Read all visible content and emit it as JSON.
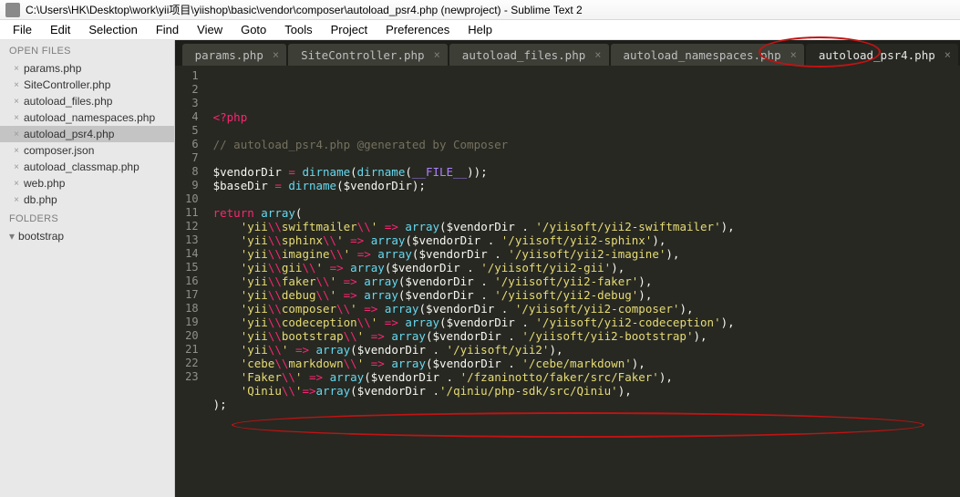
{
  "titlebar": {
    "text": "C:\\Users\\HK\\Desktop\\work\\yii项目\\yiishop\\basic\\vendor\\composer\\autoload_psr4.php (newproject) - Sublime Text 2"
  },
  "menu": [
    "File",
    "Edit",
    "Selection",
    "Find",
    "View",
    "Goto",
    "Tools",
    "Project",
    "Preferences",
    "Help"
  ],
  "sidebar": {
    "openfiles_head": "OPEN FILES",
    "openfiles": [
      "params.php",
      "SiteController.php",
      "autoload_files.php",
      "autoload_namespaces.php",
      "autoload_psr4.php",
      "composer.json",
      "autoload_classmap.php",
      "web.php",
      "db.php"
    ],
    "active_index": 4,
    "folders_head": "FOLDERS",
    "folders": [
      "bootstrap"
    ]
  },
  "tabs": {
    "items": [
      "params.php",
      "SiteController.php",
      "autoload_files.php",
      "autoload_namespaces.php",
      "autoload_psr4.php"
    ],
    "active_index": 4
  },
  "code": {
    "first_line": 1,
    "lines": [
      [
        [
          "op",
          "<?php"
        ]
      ],
      [],
      [
        [
          "cm",
          "// autoload_psr4.php @generated by Composer"
        ]
      ],
      [],
      [
        [
          "var",
          "$vendorDir "
        ],
        [
          "op",
          "="
        ],
        [
          "p",
          " "
        ],
        [
          "fn",
          "dirname"
        ],
        [
          "p",
          "("
        ],
        [
          "fn",
          "dirname"
        ],
        [
          "p",
          "("
        ],
        [
          "const",
          "__FILE__"
        ],
        [
          "p",
          "));"
        ]
      ],
      [
        [
          "var",
          "$baseDir "
        ],
        [
          "op",
          "="
        ],
        [
          "p",
          " "
        ],
        [
          "fn",
          "dirname"
        ],
        [
          "p",
          "("
        ],
        [
          "var",
          "$vendorDir"
        ],
        [
          "p",
          ");"
        ]
      ],
      [],
      [
        [
          "key",
          "return"
        ],
        [
          "p",
          " "
        ],
        [
          "fn",
          "array"
        ],
        [
          "p",
          "("
        ]
      ],
      [
        [
          "p",
          "    "
        ],
        [
          "str",
          "'yii"
        ],
        [
          "esc",
          "\\\\"
        ],
        [
          "str",
          "swiftmailer"
        ],
        [
          "esc",
          "\\\\"
        ],
        [
          "str",
          "'"
        ],
        [
          "p",
          " "
        ],
        [
          "op",
          "=>"
        ],
        [
          "p",
          " "
        ],
        [
          "fn",
          "array"
        ],
        [
          "p",
          "("
        ],
        [
          "var",
          "$vendorDir"
        ],
        [
          "p",
          " . "
        ],
        [
          "str",
          "'/yiisoft/yii2-swiftmailer'"
        ],
        [
          "p",
          "),"
        ]
      ],
      [
        [
          "p",
          "    "
        ],
        [
          "str",
          "'yii"
        ],
        [
          "esc",
          "\\\\"
        ],
        [
          "str",
          "sphinx"
        ],
        [
          "esc",
          "\\\\"
        ],
        [
          "str",
          "'"
        ],
        [
          "p",
          " "
        ],
        [
          "op",
          "=>"
        ],
        [
          "p",
          " "
        ],
        [
          "fn",
          "array"
        ],
        [
          "p",
          "("
        ],
        [
          "var",
          "$vendorDir"
        ],
        [
          "p",
          " . "
        ],
        [
          "str",
          "'/yiisoft/yii2-sphinx'"
        ],
        [
          "p",
          "),"
        ]
      ],
      [
        [
          "p",
          "    "
        ],
        [
          "str",
          "'yii"
        ],
        [
          "esc",
          "\\\\"
        ],
        [
          "str",
          "imagine"
        ],
        [
          "esc",
          "\\\\"
        ],
        [
          "str",
          "'"
        ],
        [
          "p",
          " "
        ],
        [
          "op",
          "=>"
        ],
        [
          "p",
          " "
        ],
        [
          "fn",
          "array"
        ],
        [
          "p",
          "("
        ],
        [
          "var",
          "$vendorDir"
        ],
        [
          "p",
          " . "
        ],
        [
          "str",
          "'/yiisoft/yii2-imagine'"
        ],
        [
          "p",
          "),"
        ]
      ],
      [
        [
          "p",
          "    "
        ],
        [
          "str",
          "'yii"
        ],
        [
          "esc",
          "\\\\"
        ],
        [
          "str",
          "gii"
        ],
        [
          "esc",
          "\\\\"
        ],
        [
          "str",
          "'"
        ],
        [
          "p",
          " "
        ],
        [
          "op",
          "=>"
        ],
        [
          "p",
          " "
        ],
        [
          "fn",
          "array"
        ],
        [
          "p",
          "("
        ],
        [
          "var",
          "$vendorDir"
        ],
        [
          "p",
          " . "
        ],
        [
          "str",
          "'/yiisoft/yii2-gii'"
        ],
        [
          "p",
          "),"
        ]
      ],
      [
        [
          "p",
          "    "
        ],
        [
          "str",
          "'yii"
        ],
        [
          "esc",
          "\\\\"
        ],
        [
          "str",
          "faker"
        ],
        [
          "esc",
          "\\\\"
        ],
        [
          "str",
          "'"
        ],
        [
          "p",
          " "
        ],
        [
          "op",
          "=>"
        ],
        [
          "p",
          " "
        ],
        [
          "fn",
          "array"
        ],
        [
          "p",
          "("
        ],
        [
          "var",
          "$vendorDir"
        ],
        [
          "p",
          " . "
        ],
        [
          "str",
          "'/yiisoft/yii2-faker'"
        ],
        [
          "p",
          "),"
        ]
      ],
      [
        [
          "p",
          "    "
        ],
        [
          "str",
          "'yii"
        ],
        [
          "esc",
          "\\\\"
        ],
        [
          "str",
          "debug"
        ],
        [
          "esc",
          "\\\\"
        ],
        [
          "str",
          "'"
        ],
        [
          "p",
          " "
        ],
        [
          "op",
          "=>"
        ],
        [
          "p",
          " "
        ],
        [
          "fn",
          "array"
        ],
        [
          "p",
          "("
        ],
        [
          "var",
          "$vendorDir"
        ],
        [
          "p",
          " . "
        ],
        [
          "str",
          "'/yiisoft/yii2-debug'"
        ],
        [
          "p",
          "),"
        ]
      ],
      [
        [
          "p",
          "    "
        ],
        [
          "str",
          "'yii"
        ],
        [
          "esc",
          "\\\\"
        ],
        [
          "str",
          "composer"
        ],
        [
          "esc",
          "\\\\"
        ],
        [
          "str",
          "'"
        ],
        [
          "p",
          " "
        ],
        [
          "op",
          "=>"
        ],
        [
          "p",
          " "
        ],
        [
          "fn",
          "array"
        ],
        [
          "p",
          "("
        ],
        [
          "var",
          "$vendorDir"
        ],
        [
          "p",
          " . "
        ],
        [
          "str",
          "'/yiisoft/yii2-composer'"
        ],
        [
          "p",
          "),"
        ]
      ],
      [
        [
          "p",
          "    "
        ],
        [
          "str",
          "'yii"
        ],
        [
          "esc",
          "\\\\"
        ],
        [
          "str",
          "codeception"
        ],
        [
          "esc",
          "\\\\"
        ],
        [
          "str",
          "'"
        ],
        [
          "p",
          " "
        ],
        [
          "op",
          "=>"
        ],
        [
          "p",
          " "
        ],
        [
          "fn",
          "array"
        ],
        [
          "p",
          "("
        ],
        [
          "var",
          "$vendorDir"
        ],
        [
          "p",
          " . "
        ],
        [
          "str",
          "'/yiisoft/yii2-codeception'"
        ],
        [
          "p",
          "),"
        ]
      ],
      [
        [
          "p",
          "    "
        ],
        [
          "str",
          "'yii"
        ],
        [
          "esc",
          "\\\\"
        ],
        [
          "str",
          "bootstrap"
        ],
        [
          "esc",
          "\\\\"
        ],
        [
          "str",
          "'"
        ],
        [
          "p",
          " "
        ],
        [
          "op",
          "=>"
        ],
        [
          "p",
          " "
        ],
        [
          "fn",
          "array"
        ],
        [
          "p",
          "("
        ],
        [
          "var",
          "$vendorDir"
        ],
        [
          "p",
          " . "
        ],
        [
          "str",
          "'/yiisoft/yii2-bootstrap'"
        ],
        [
          "p",
          "),"
        ]
      ],
      [
        [
          "p",
          "    "
        ],
        [
          "str",
          "'yii"
        ],
        [
          "esc",
          "\\\\"
        ],
        [
          "str",
          "'"
        ],
        [
          "p",
          " "
        ],
        [
          "op",
          "=>"
        ],
        [
          "p",
          " "
        ],
        [
          "fn",
          "array"
        ],
        [
          "p",
          "("
        ],
        [
          "var",
          "$vendorDir"
        ],
        [
          "p",
          " . "
        ],
        [
          "str",
          "'/yiisoft/yii2'"
        ],
        [
          "p",
          "),"
        ]
      ],
      [
        [
          "p",
          "    "
        ],
        [
          "str",
          "'cebe"
        ],
        [
          "esc",
          "\\\\"
        ],
        [
          "str",
          "markdown"
        ],
        [
          "esc",
          "\\\\"
        ],
        [
          "str",
          "'"
        ],
        [
          "p",
          " "
        ],
        [
          "op",
          "=>"
        ],
        [
          "p",
          " "
        ],
        [
          "fn",
          "array"
        ],
        [
          "p",
          "("
        ],
        [
          "var",
          "$vendorDir"
        ],
        [
          "p",
          " . "
        ],
        [
          "str",
          "'/cebe/markdown'"
        ],
        [
          "p",
          "),"
        ]
      ],
      [
        [
          "p",
          "    "
        ],
        [
          "str",
          "'Faker"
        ],
        [
          "esc",
          "\\\\"
        ],
        [
          "str",
          "'"
        ],
        [
          "p",
          " "
        ],
        [
          "op",
          "=>"
        ],
        [
          "p",
          " "
        ],
        [
          "fn",
          "array"
        ],
        [
          "p",
          "("
        ],
        [
          "var",
          "$vendorDir"
        ],
        [
          "p",
          " . "
        ],
        [
          "str",
          "'/fzaninotto/faker/src/Faker'"
        ],
        [
          "p",
          "),"
        ]
      ],
      [
        [
          "p",
          "    "
        ],
        [
          "str",
          "'Qiniu"
        ],
        [
          "esc",
          "\\\\"
        ],
        [
          "str",
          "'"
        ],
        [
          "op",
          "=>"
        ],
        [
          "fn",
          "array"
        ],
        [
          "p",
          "("
        ],
        [
          "var",
          "$vendorDir"
        ],
        [
          "p",
          " ."
        ],
        [
          "str",
          "'/qiniu/php-sdk/src/Qiniu'"
        ],
        [
          "p",
          "),"
        ]
      ],
      [
        [
          "p",
          ");"
        ]
      ],
      []
    ]
  }
}
